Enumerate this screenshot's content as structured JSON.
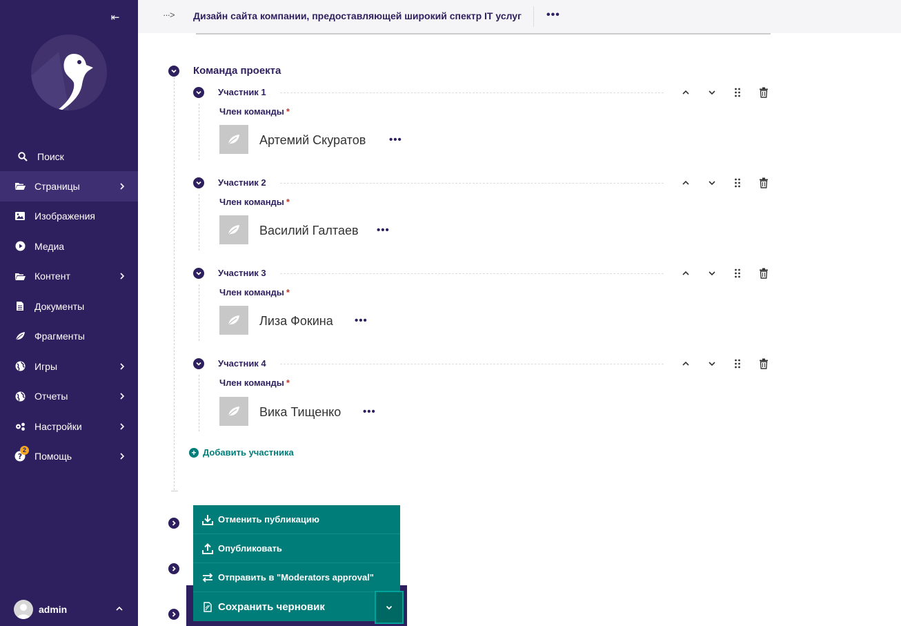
{
  "sidebar": {
    "collapse_glyph": "⇤",
    "items": [
      {
        "label": "Поиск",
        "icon": "search-icon"
      },
      {
        "label": "Страницы",
        "icon": "folder-icon",
        "has_children": true,
        "active": true
      },
      {
        "label": "Изображения",
        "icon": "image-icon"
      },
      {
        "label": "Медиа",
        "icon": "play-icon"
      },
      {
        "label": "Контент",
        "icon": "folder-icon",
        "has_children": true
      },
      {
        "label": "Документы",
        "icon": "document-icon"
      },
      {
        "label": "Фрагменты",
        "icon": "leaf-icon"
      },
      {
        "label": "Игры",
        "icon": "globe-icon",
        "has_children": true
      },
      {
        "label": "Отчеты",
        "icon": "globe-icon",
        "has_children": true
      },
      {
        "label": "Настройки",
        "icon": "cogs-icon",
        "has_children": true
      },
      {
        "label": "Помощь",
        "icon": "help-icon",
        "has_children": true,
        "badge": "2"
      }
    ],
    "user": {
      "name": "admin"
    }
  },
  "topbar": {
    "breadcrumb_glyph": "···>",
    "title": "Дизайн сайта компании, предоставляющей широкий спектр IT услуг",
    "more": "•••"
  },
  "section": {
    "title": "Команда проекта",
    "field_label": "Член команды",
    "required_mark": "*",
    "members": [
      {
        "title": "Участник 1",
        "name": "Артемий Скуратов"
      },
      {
        "title": "Участник 2",
        "name": "Василий Галтаев"
      },
      {
        "title": "Участник 3",
        "name": "Лиза Фокина"
      },
      {
        "title": "Участник 4",
        "name": "Вика Тищенко"
      }
    ],
    "more": "•••",
    "add_label": "Добавить участника"
  },
  "actions": {
    "unpublish": "Отменить публикацию",
    "publish": "Опубликовать",
    "send": "Отправить в \"Moderators approval\"",
    "save_draft": "Сохранить черновик"
  },
  "colors": {
    "sidebar_bg": "#2e1f5e",
    "accent": "#007d79",
    "badge": "#f5a623",
    "required": "#c0392b"
  }
}
